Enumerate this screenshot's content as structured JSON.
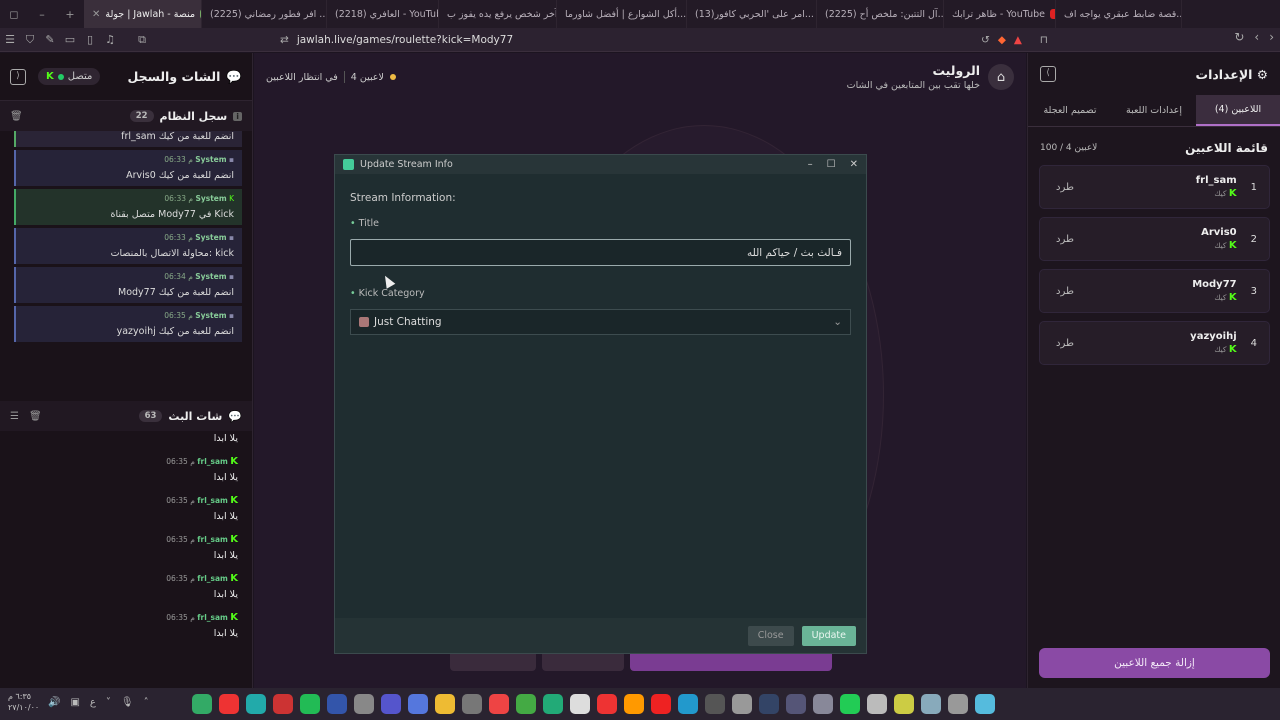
{
  "browser": {
    "tabs": [
      {
        "label": "قصة ضابط عبقري يواجه اف...",
        "type": "yt"
      },
      {
        "label": "ظاهر ترابك - YouTube",
        "type": "yt"
      },
      {
        "label": "(2225) آل التتبن: ملخص أح...",
        "type": "yt"
      },
      {
        "label": "(13)امر على 'الحربي كافور...",
        "type": "tt"
      },
      {
        "label": "أكل الشوارع | أفضل شاورما...",
        "type": "yt"
      },
      {
        "label": "آخر شخص يرفع يده يفوز ب...",
        "type": "yt"
      },
      {
        "label": "(2218) العافري - YouTube",
        "type": "yt"
      },
      {
        "label": "(2225) افر فطور رمضاني ...",
        "type": "yt"
      },
      {
        "label": "جولة | Jawlah - منصة",
        "type": "jw",
        "active": true
      }
    ],
    "url": "jawlah.live/games/roulette?kick=Mody77"
  },
  "left": {
    "title": "الشات والسجل",
    "status": "متصل",
    "syslog_title": "سجل النظام",
    "syslog_count": "22",
    "sys_first": "frl_sam انضم للعبة من كيك",
    "sys_messages": [
      {
        "sender": "System",
        "time": "06:33 م",
        "text": "Arvis0 انضم للعبة من كيك",
        "tone": "blue"
      },
      {
        "sender": "System",
        "time": "06:33 م",
        "text": "متصل بقناة Mody77 في Kick",
        "tone": "green"
      },
      {
        "sender": "System",
        "time": "06:33 م",
        "text": "محاولة الاتصال بالمنصات: kick",
        "tone": "blue"
      },
      {
        "sender": "System",
        "time": "06:34 م",
        "text": "Mody77 انضم للعبة من كيك",
        "tone": "blue"
      },
      {
        "sender": "System",
        "time": "06:35 م",
        "text": "yazyoihj انضم للعبة من كيك",
        "tone": "blue"
      }
    ],
    "chat_title": "شات البث",
    "chat_count": "63",
    "chat_first": "يلا ابدا",
    "chat_messages": [
      {
        "user": "frl_sam",
        "time": "06:35 م",
        "text": "يلا ابدا"
      },
      {
        "user": "frl_sam",
        "time": "06:35 م",
        "text": "يلا ابدا"
      },
      {
        "user": "frl_sam",
        "time": "06:35 م",
        "text": "يلا ابدا"
      },
      {
        "user": "frl_sam",
        "time": "06:35 م",
        "text": "يلا ابدا"
      },
      {
        "user": "frl_sam",
        "time": "06:35 م",
        "text": "يلا ابدا"
      }
    ]
  },
  "center": {
    "title": "الروليت",
    "subtitle": "خلها تقب بين المتابعين في الشات",
    "players_count": "4 لاعبين",
    "state": "في انتظار اللاعبين"
  },
  "right": {
    "title": "الإعدادات",
    "tabs": [
      "اللاعبين (4)",
      "إعدادات اللعبة",
      "تصميم العجلة"
    ],
    "list_title": "قائمة اللاعبين",
    "list_count": "100 / 4 لاعبين",
    "kick_label": "طرد",
    "platform": "كيك",
    "players": [
      {
        "num": "1",
        "name": "frl_sam"
      },
      {
        "num": "2",
        "name": "Arvis0"
      },
      {
        "num": "3",
        "name": "Mody77"
      },
      {
        "num": "4",
        "name": "yazyoihj"
      }
    ],
    "remove_all": "إزالة جميع اللاعبين"
  },
  "modal": {
    "window_title": "Update Stream Info",
    "section": "Stream Information:",
    "title_label": "Title",
    "title_value": "فـالث بث / حياكم الله",
    "category_label": "Kick Category",
    "category_value": "Just Chatting",
    "close": "Close",
    "update": "Update"
  },
  "taskbar": {
    "time": "٦:٣٥ م",
    "date": "٢٧/١٠/٠٠",
    "lang": "ع"
  },
  "colors": {
    "accent": "#8a4aa5",
    "kick": "#53fc18",
    "update_btn": "#6ab497"
  }
}
